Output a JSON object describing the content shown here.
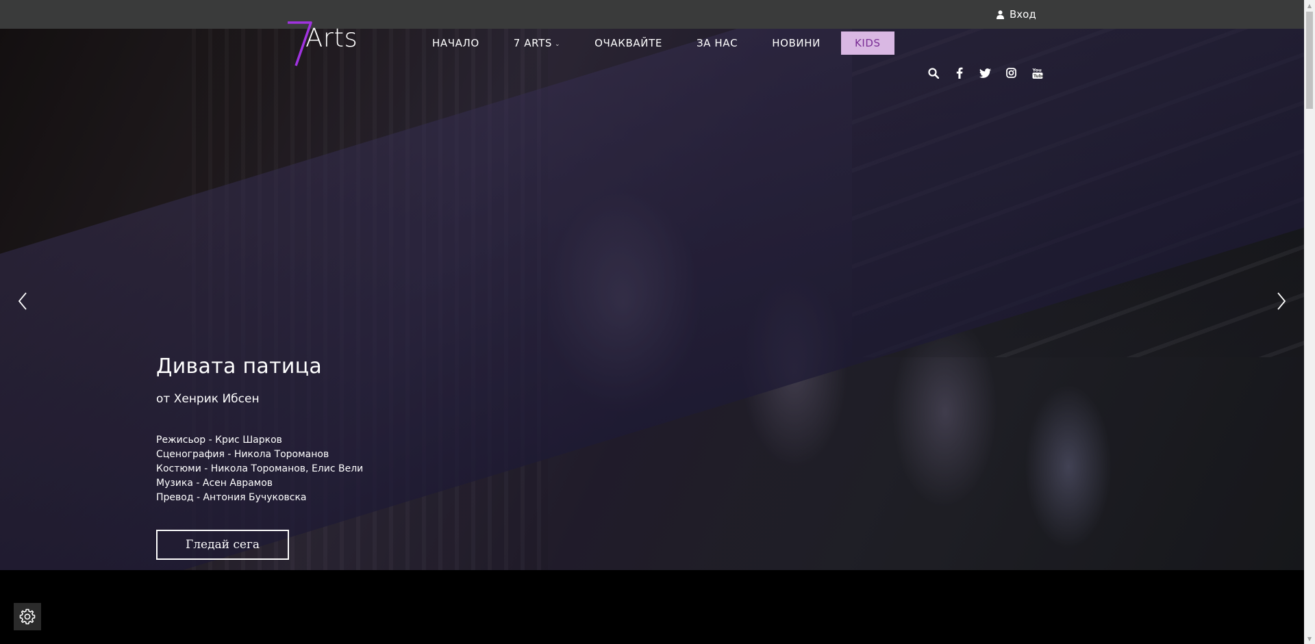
{
  "topbar": {
    "login_label": "Вход",
    "user_icon": "user-icon"
  },
  "logo": {
    "text": "Arts",
    "accent_color": "#a033e0"
  },
  "nav": {
    "items": [
      {
        "label": "НАЧАЛО"
      },
      {
        "label": "7 ARTS",
        "has_dropdown": true
      },
      {
        "label": "ОЧАКВАЙТЕ"
      },
      {
        "label": "ЗА НАС"
      },
      {
        "label": "НОВИНИ"
      }
    ],
    "kids_label": "KIDS",
    "kids_bg": "#d9b8e3",
    "kids_color": "#7a2e95"
  },
  "social": [
    "search-icon",
    "facebook-icon",
    "twitter-icon",
    "instagram-icon",
    "youtube-icon"
  ],
  "hero": {
    "title": "Дивата патица",
    "author": "от Хенрик Ибсен",
    "credits": [
      "Режисьор - Крис Шарков",
      "Сценография - Никола Тороманов",
      "Костюми - Никола Тороманов, Елис Вели",
      "Музика - Асен Аврамов",
      "Превод - Антония Бучуковска"
    ],
    "button_label": "Гледай сега"
  }
}
